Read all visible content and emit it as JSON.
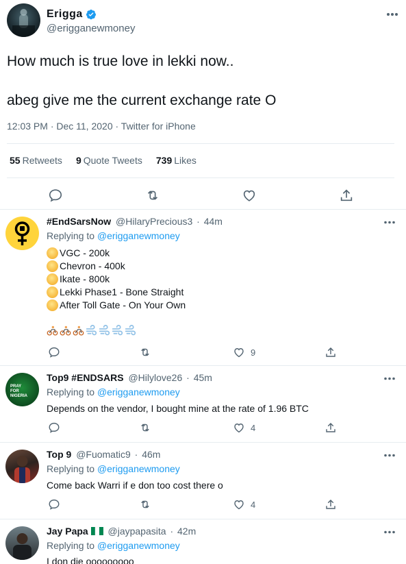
{
  "main_tweet": {
    "author_name": "Erigga",
    "author_handle": "@erigganewmoney",
    "text_line1": "How much is true love in lekki now..",
    "text_line2": "abeg give me the current exchange rate O",
    "meta": "12:03 PM · Dec 11, 2020 · Twitter for iPhone",
    "stats": {
      "retweets_count": "55",
      "retweets_label": "Retweets",
      "quotes_count": "9",
      "quotes_label": "Quote Tweets",
      "likes_count": "739",
      "likes_label": "Likes"
    }
  },
  "replies": [
    {
      "name": "#EndSarsNow",
      "handle": "@HilaryPrecious3",
      "time": "44m",
      "replying_prefix": "Replying to",
      "replying_to": "@erigganewmoney",
      "lines": [
        "VGC - 200k",
        "Chevron - 400k",
        "Ikate - 800k",
        "Lekki Phase1 - Bone Straight",
        "After Toll Gate - On Your Own"
      ],
      "likes": "9"
    },
    {
      "name": "Top9 #ENDSARS",
      "handle": "@Hilylove26",
      "time": "45m",
      "replying_prefix": "Replying to",
      "replying_to": "@erigganewmoney",
      "text": "Depends on the vendor, I bought mine at the rate of 1.96 BTC",
      "avatar_text_1": "PRAY",
      "avatar_text_2": "FOR",
      "avatar_text_3": "NIGERIA",
      "likes": "4"
    },
    {
      "name": "Top 9",
      "handle": "@Fuomatic9",
      "time": "46m",
      "replying_prefix": "Replying to",
      "replying_to": "@erigganewmoney",
      "text": "Come back Warri if e don too cost there o",
      "likes": "4"
    },
    {
      "name": "Jay Papa",
      "handle": "@jaypapasita",
      "time": "42m",
      "replying_prefix": "Replying to",
      "replying_to": "@erigganewmoney",
      "text": "I don die ooooooooo"
    }
  ],
  "separator_dot": "·",
  "colors": {
    "link_blue": "#1d9bf0",
    "muted_gray": "#536471",
    "verified_blue": "#1d9bf0"
  }
}
